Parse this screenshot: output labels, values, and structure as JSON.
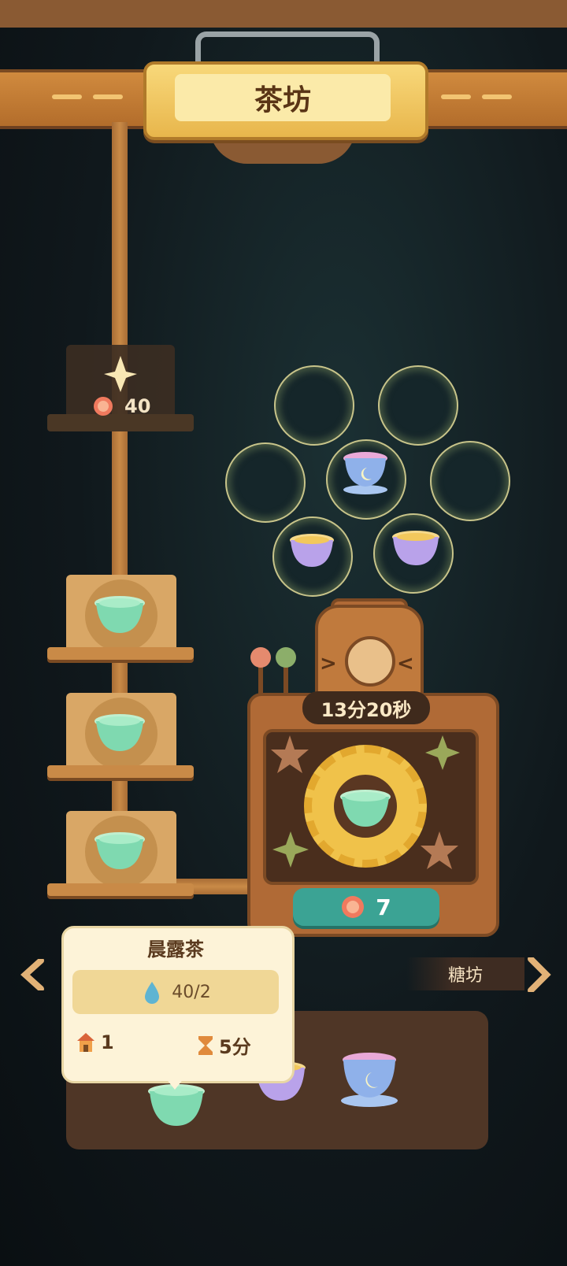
{
  "header": {
    "title": "茶坊"
  },
  "locked_shelf": {
    "cost": "40"
  },
  "machine": {
    "timer": "13分20秒",
    "speedup_cost": "7"
  },
  "nav": {
    "right_label": "糖坊"
  },
  "tooltip": {
    "name": "晨露茶",
    "progress": "40/2",
    "count": "1",
    "time": "5分"
  },
  "icons": {
    "currency": "flower-coin-icon",
    "sparkle": "sparkle-icon",
    "dew": "dew-icon",
    "house": "house-icon",
    "hourglass": "hourglass-icon"
  },
  "colors": {
    "teal_button": "#3ba394",
    "cream": "#fdf3d8"
  }
}
